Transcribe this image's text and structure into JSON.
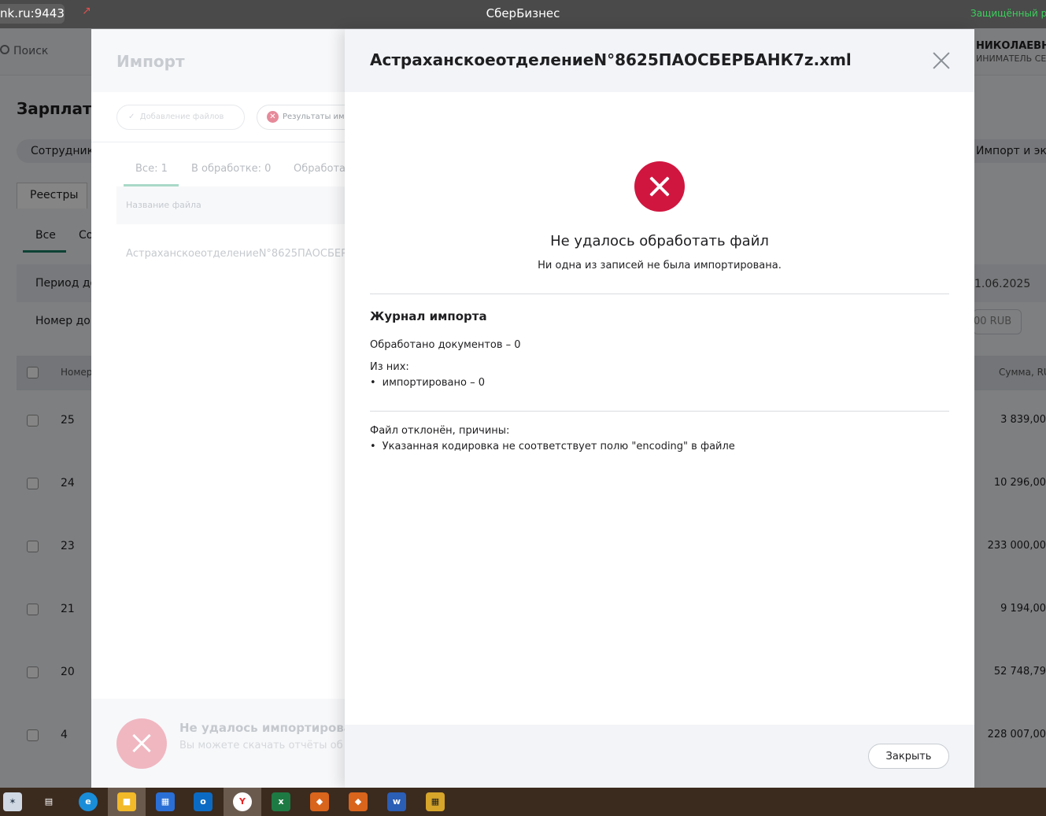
{
  "browser": {
    "address": "nk.ru:9443",
    "title": "СберБизнес",
    "secure_label": "Защищённый ре"
  },
  "background_app": {
    "search_label": "Поиск",
    "user_name": "НИКОЛАЕВНА",
    "user_role": "ИНИМАТЕЛЬ СЕ",
    "page_title": "Зарплатны",
    "pill_employees": "Сотрудники",
    "pill_import_export": "Импорт и экс",
    "tab_registries": "Реестры",
    "subtab_all": "Все",
    "subtab_co": "Со",
    "filter_period": "Период до",
    "filter_number": "Номер док",
    "date_value": "1.06.2025",
    "rub_value": "00 RUB",
    "th_number": "Номер",
    "th_sum": "Сумма, RU",
    "rows": [
      {
        "num": "25",
        "sum": "3 839,00"
      },
      {
        "num": "24",
        "sum": "10 296,00"
      },
      {
        "num": "23",
        "sum": "233 000,00"
      },
      {
        "num": "21",
        "sum": "9 194,00"
      },
      {
        "num": "20",
        "sum": "52 748,79"
      },
      {
        "num": "4",
        "sum": "228 007,00"
      }
    ]
  },
  "import_panel": {
    "title": "Импорт",
    "step_add_files": "Добавление файлов",
    "step_results": "Результаты им",
    "tab_all": "Все: 1",
    "tab_processing": "В обработке: 0",
    "tab_processed": "Обработа",
    "column_file_name": "Название файла",
    "file_name": "АстраханскоеотделениеN°8625ПАОСБЕРБ",
    "bottom_title": "Не удалось импортировать",
    "bottom_sub": "Вы можете скачать отчёты об о"
  },
  "modal": {
    "title": "АстраханскоеотделениеN°8625ПАОСБЕРБАНК7z.xml",
    "error_title": "Не удалось обработать файл",
    "error_subtitle": "Ни одна из записей не была импортирована.",
    "log_title": "Журнал импорта",
    "processed_docs": "Обработано документов – 0",
    "of_them": "Из них:",
    "imported": "импортировано – 0",
    "rejected_title": "Файл отклонён, причины:",
    "rejected_reason": "Указанная кодировка не соответствует полю \"encoding\" в файле",
    "close_button": "Закрыть"
  },
  "colors": {
    "error_red": "#d0163f",
    "accent_green": "#1a7f64"
  },
  "taskbar": {
    "icons": [
      "start-icon",
      "task-view-icon",
      "edge-icon",
      "file-explorer-icon",
      "store-icon",
      "outlook-icon",
      "yandex-browser-icon",
      "excel-icon",
      "firefox-icon",
      "firefox-icon",
      "word-icon",
      "calculator-icon"
    ]
  }
}
